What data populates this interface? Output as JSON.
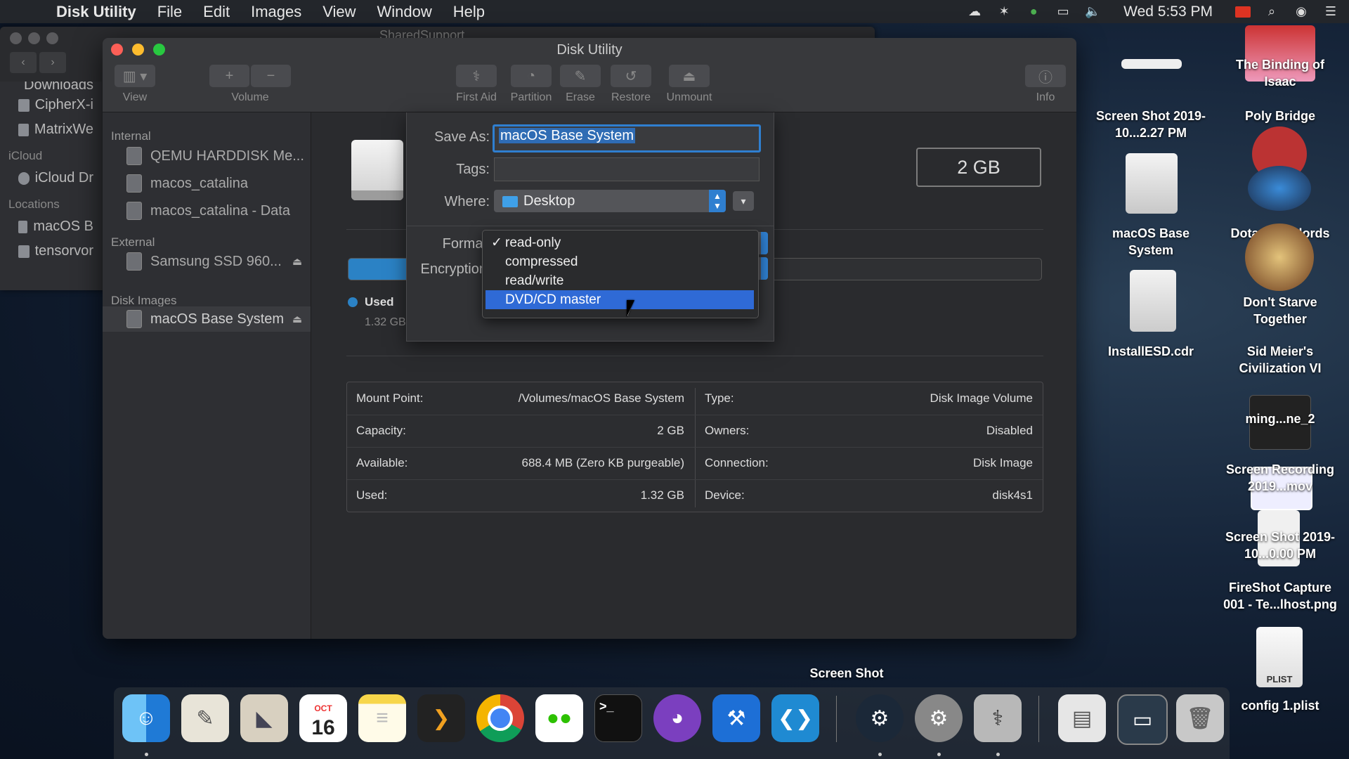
{
  "menubar": {
    "app_name": "Disk Utility",
    "items": [
      "File",
      "Edit",
      "Images",
      "View",
      "Window",
      "Help"
    ],
    "clock": "Wed 5:53 PM"
  },
  "finder": {
    "path_fragment": "SharedSupport",
    "items": [
      "Downloads",
      "CipherX-i",
      "MatrixWe"
    ],
    "icloud_header": "iCloud",
    "icloud_item": "iCloud Dr",
    "locations_header": "Locations",
    "locations": [
      "macOS B",
      "tensorvor"
    ]
  },
  "window": {
    "title": "Disk Utility",
    "toolbar": {
      "view": "View",
      "volume": "Volume",
      "first_aid": "First Aid",
      "partition": "Partition",
      "erase": "Erase",
      "restore": "Restore",
      "unmount": "Unmount",
      "info": "Info"
    }
  },
  "sidebar": {
    "internal_header": "Internal",
    "internal": [
      "QEMU HARDDISK Me...",
      "macos_catalina",
      "macos_catalina - Data"
    ],
    "external_header": "External",
    "external": [
      "Samsung SSD 960..."
    ],
    "disk_images_header": "Disk Images",
    "disk_images": [
      "macOS Base System"
    ]
  },
  "main": {
    "capacity_box": "2 GB",
    "legend_used": "Used",
    "legend_used_value": "1.32 GB",
    "used_fraction": 0.43
  },
  "info": {
    "left": [
      {
        "label": "Mount Point:",
        "value": "/Volumes/macOS Base System"
      },
      {
        "label": "Capacity:",
        "value": "2 GB"
      },
      {
        "label": "Available:",
        "value": "688.4 MB (Zero KB purgeable)"
      },
      {
        "label": "Used:",
        "value": "1.32 GB"
      }
    ],
    "right": [
      {
        "label": "Type:",
        "value": "Disk Image Volume"
      },
      {
        "label": "Owners:",
        "value": "Disabled"
      },
      {
        "label": "Connection:",
        "value": "Disk Image"
      },
      {
        "label": "Device:",
        "value": "disk4s1"
      }
    ]
  },
  "sheet": {
    "save_as_label": "Save As:",
    "save_as_value": "macOS Base System",
    "tags_label": "Tags:",
    "where_label": "Where:",
    "where_value": "Desktop",
    "format_label": "Format",
    "encryption_label": "Encryption"
  },
  "format_menu": {
    "options": [
      "read-only",
      "compressed",
      "read/write",
      "DVD/CD master"
    ],
    "checked": "read-only",
    "highlighted": "DVD/CD master"
  },
  "desktop": {
    "items": [
      "The Binding of Isaac",
      "Screen Shot 2019-10...2.27 PM",
      "Poly Bridge",
      "macOS Base System",
      "Dota Underlords",
      "InstallESD.cdr",
      "Don't Starve Together",
      "Sid Meier's Civilization VI",
      "ming...ne_2",
      "Screen Recording 2019...mov",
      "Screen Shot 2019-10...0.00 PM",
      "FireShot Capture 001 - Te...lhost.png",
      "config 1.plist",
      "Screen Shot"
    ],
    "plist_badge": "PLIST"
  },
  "dock": {
    "calendar_month": "OCT",
    "calendar_day": "16",
    "apps": [
      "finder-icon",
      "textedit-icon",
      "preview-icon",
      "calendar-icon",
      "notes-icon",
      "plex-icon",
      "chrome-icon",
      "wechat-icon",
      "terminal-icon",
      "github-desktop-icon",
      "xcode-icon",
      "vscode-icon",
      "steam-icon",
      "system-preferences-icon",
      "disk-utility-icon",
      "file-icon",
      "screenshot-icon",
      "trash-icon"
    ]
  },
  "colors": {
    "accent": "#2f6ad6",
    "used": "#2b82c5"
  }
}
